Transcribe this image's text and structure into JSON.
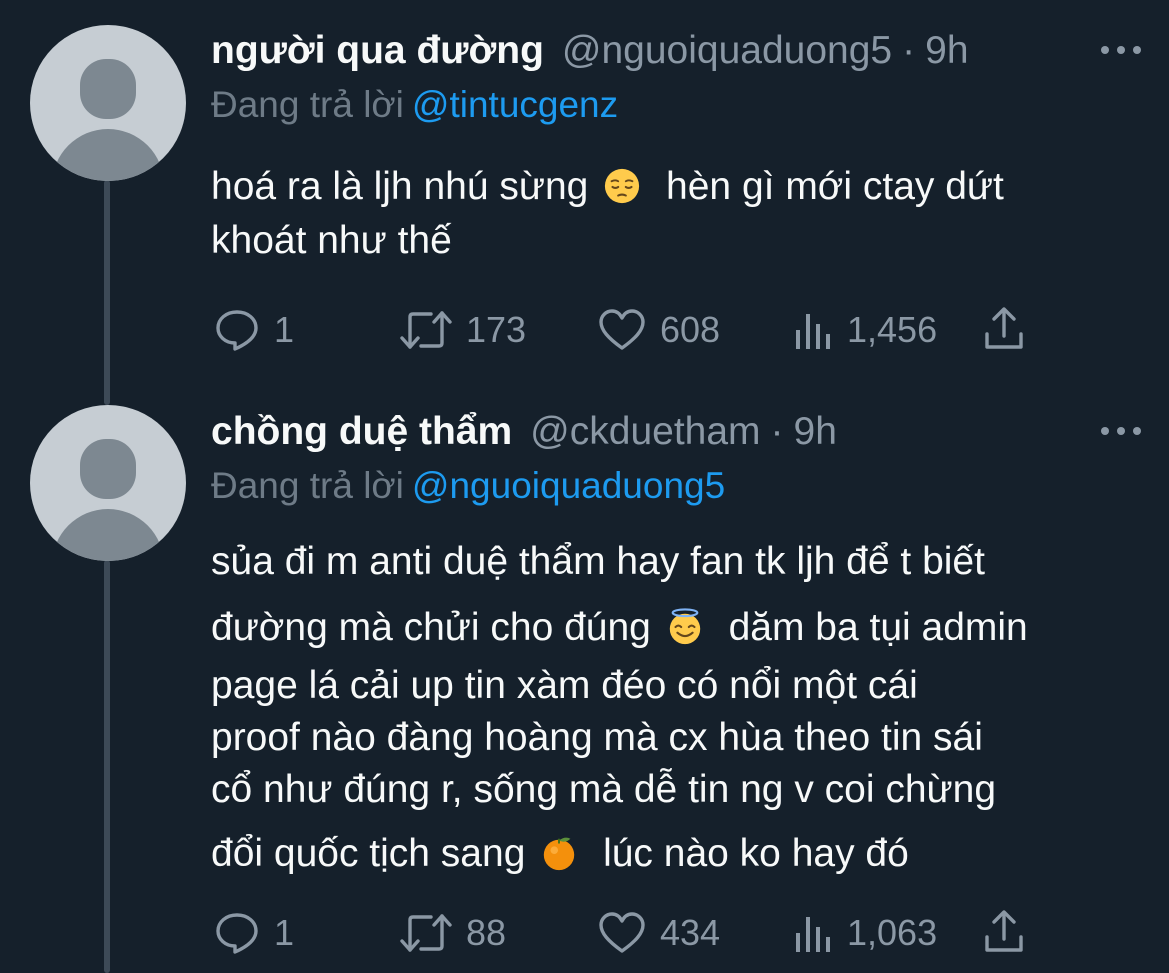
{
  "tweets": [
    {
      "display_name": "người qua đường",
      "handle": "@nguoiquaduong5",
      "separator": "·",
      "time": "9h",
      "reply_prefix": "Đang trả lời",
      "reply_to": "@tintucgenz",
      "text_parts": [
        "hoá ra là ljh nhú sừng",
        "hèn gì mới ctay dứt",
        "khoát như thế"
      ],
      "emoji": "pensive-face-emoji",
      "stats": {
        "replies": "1",
        "retweets": "173",
        "likes": "608",
        "views": "1,456"
      }
    },
    {
      "display_name": "chồng duệ thẩm",
      "handle": "@ckduetham",
      "separator": "·",
      "time": "9h",
      "reply_prefix": "Đang trả lời",
      "reply_to": "@nguoiquaduong5",
      "text_lines": [
        "sủa đi m anti duệ thẩm hay fan tk ljh để t biết",
        "đường mà chửi cho đúng",
        "dăm ba tụi admin",
        "page lá cải up tin xàm đéo có nổi một cái",
        "proof nào đàng hoàng mà cx hùa theo tin sái",
        "cổ như đúng r, sống mà dễ tin ng v coi chừng",
        "đổi quốc tịch sang",
        "lúc nào ko hay đó"
      ],
      "emojis": [
        "smiling-face-with-halo-emoji",
        "tangerine-emoji"
      ],
      "stats": {
        "replies": "1",
        "retweets": "88",
        "likes": "434",
        "views": "1,063"
      }
    }
  ],
  "icons": {
    "reply": "speech-bubble-icon",
    "retweet": "retweet-arrows-icon",
    "like": "heart-icon",
    "views": "bar-chart-icon",
    "share": "share-upload-icon",
    "more": "more-dots-icon"
  },
  "colors": {
    "background": "#15202b",
    "text_primary": "#f7f9f9",
    "text_secondary": "#8b98a5",
    "mention": "#1d9bf0",
    "thread_line": "#3d4a57"
  }
}
